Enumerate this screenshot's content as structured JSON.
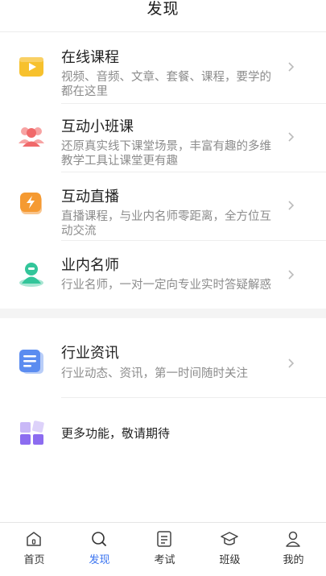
{
  "header": {
    "title": "发现"
  },
  "items": [
    {
      "name": "在线课程",
      "desc": "视频、音频、文章、套餐、课程，要学的都在这里",
      "icon": "play-video-icon"
    },
    {
      "name": "互动小班课",
      "desc": "还原真实线下课堂场景，丰富有趣的多维教学工具让课堂更有趣",
      "icon": "group-users-icon"
    },
    {
      "name": "互动直播",
      "desc": "直播课程，与业内名师零距离，全方位互动交流",
      "icon": "lightning-live-icon"
    },
    {
      "name": "业内名师",
      "desc": "行业名师，一对一定向专业实时答疑解惑",
      "icon": "teacher-icon"
    }
  ],
  "news": {
    "name": "行业资讯",
    "desc": "行业动态、资讯，第一时间随时关注",
    "icon": "document-icon"
  },
  "more": {
    "name": "更多功能，敬请期待",
    "icon": "grid-apps-icon"
  },
  "tabs": [
    {
      "label": "首页",
      "icon": "home-icon"
    },
    {
      "label": "发现",
      "icon": "search-discover-icon",
      "active": true
    },
    {
      "label": "考试",
      "icon": "exam-doc-icon"
    },
    {
      "label": "班级",
      "icon": "graduation-cap-icon"
    },
    {
      "label": "我的",
      "icon": "user-icon"
    }
  ],
  "colors": {
    "accent": "#3b74f0",
    "yellow": "#f7c12d",
    "red": "#f0696a",
    "orange": "#f59a32",
    "green": "#33c59a",
    "blue": "#5b8cf0",
    "purple": "#8c6cf0"
  }
}
